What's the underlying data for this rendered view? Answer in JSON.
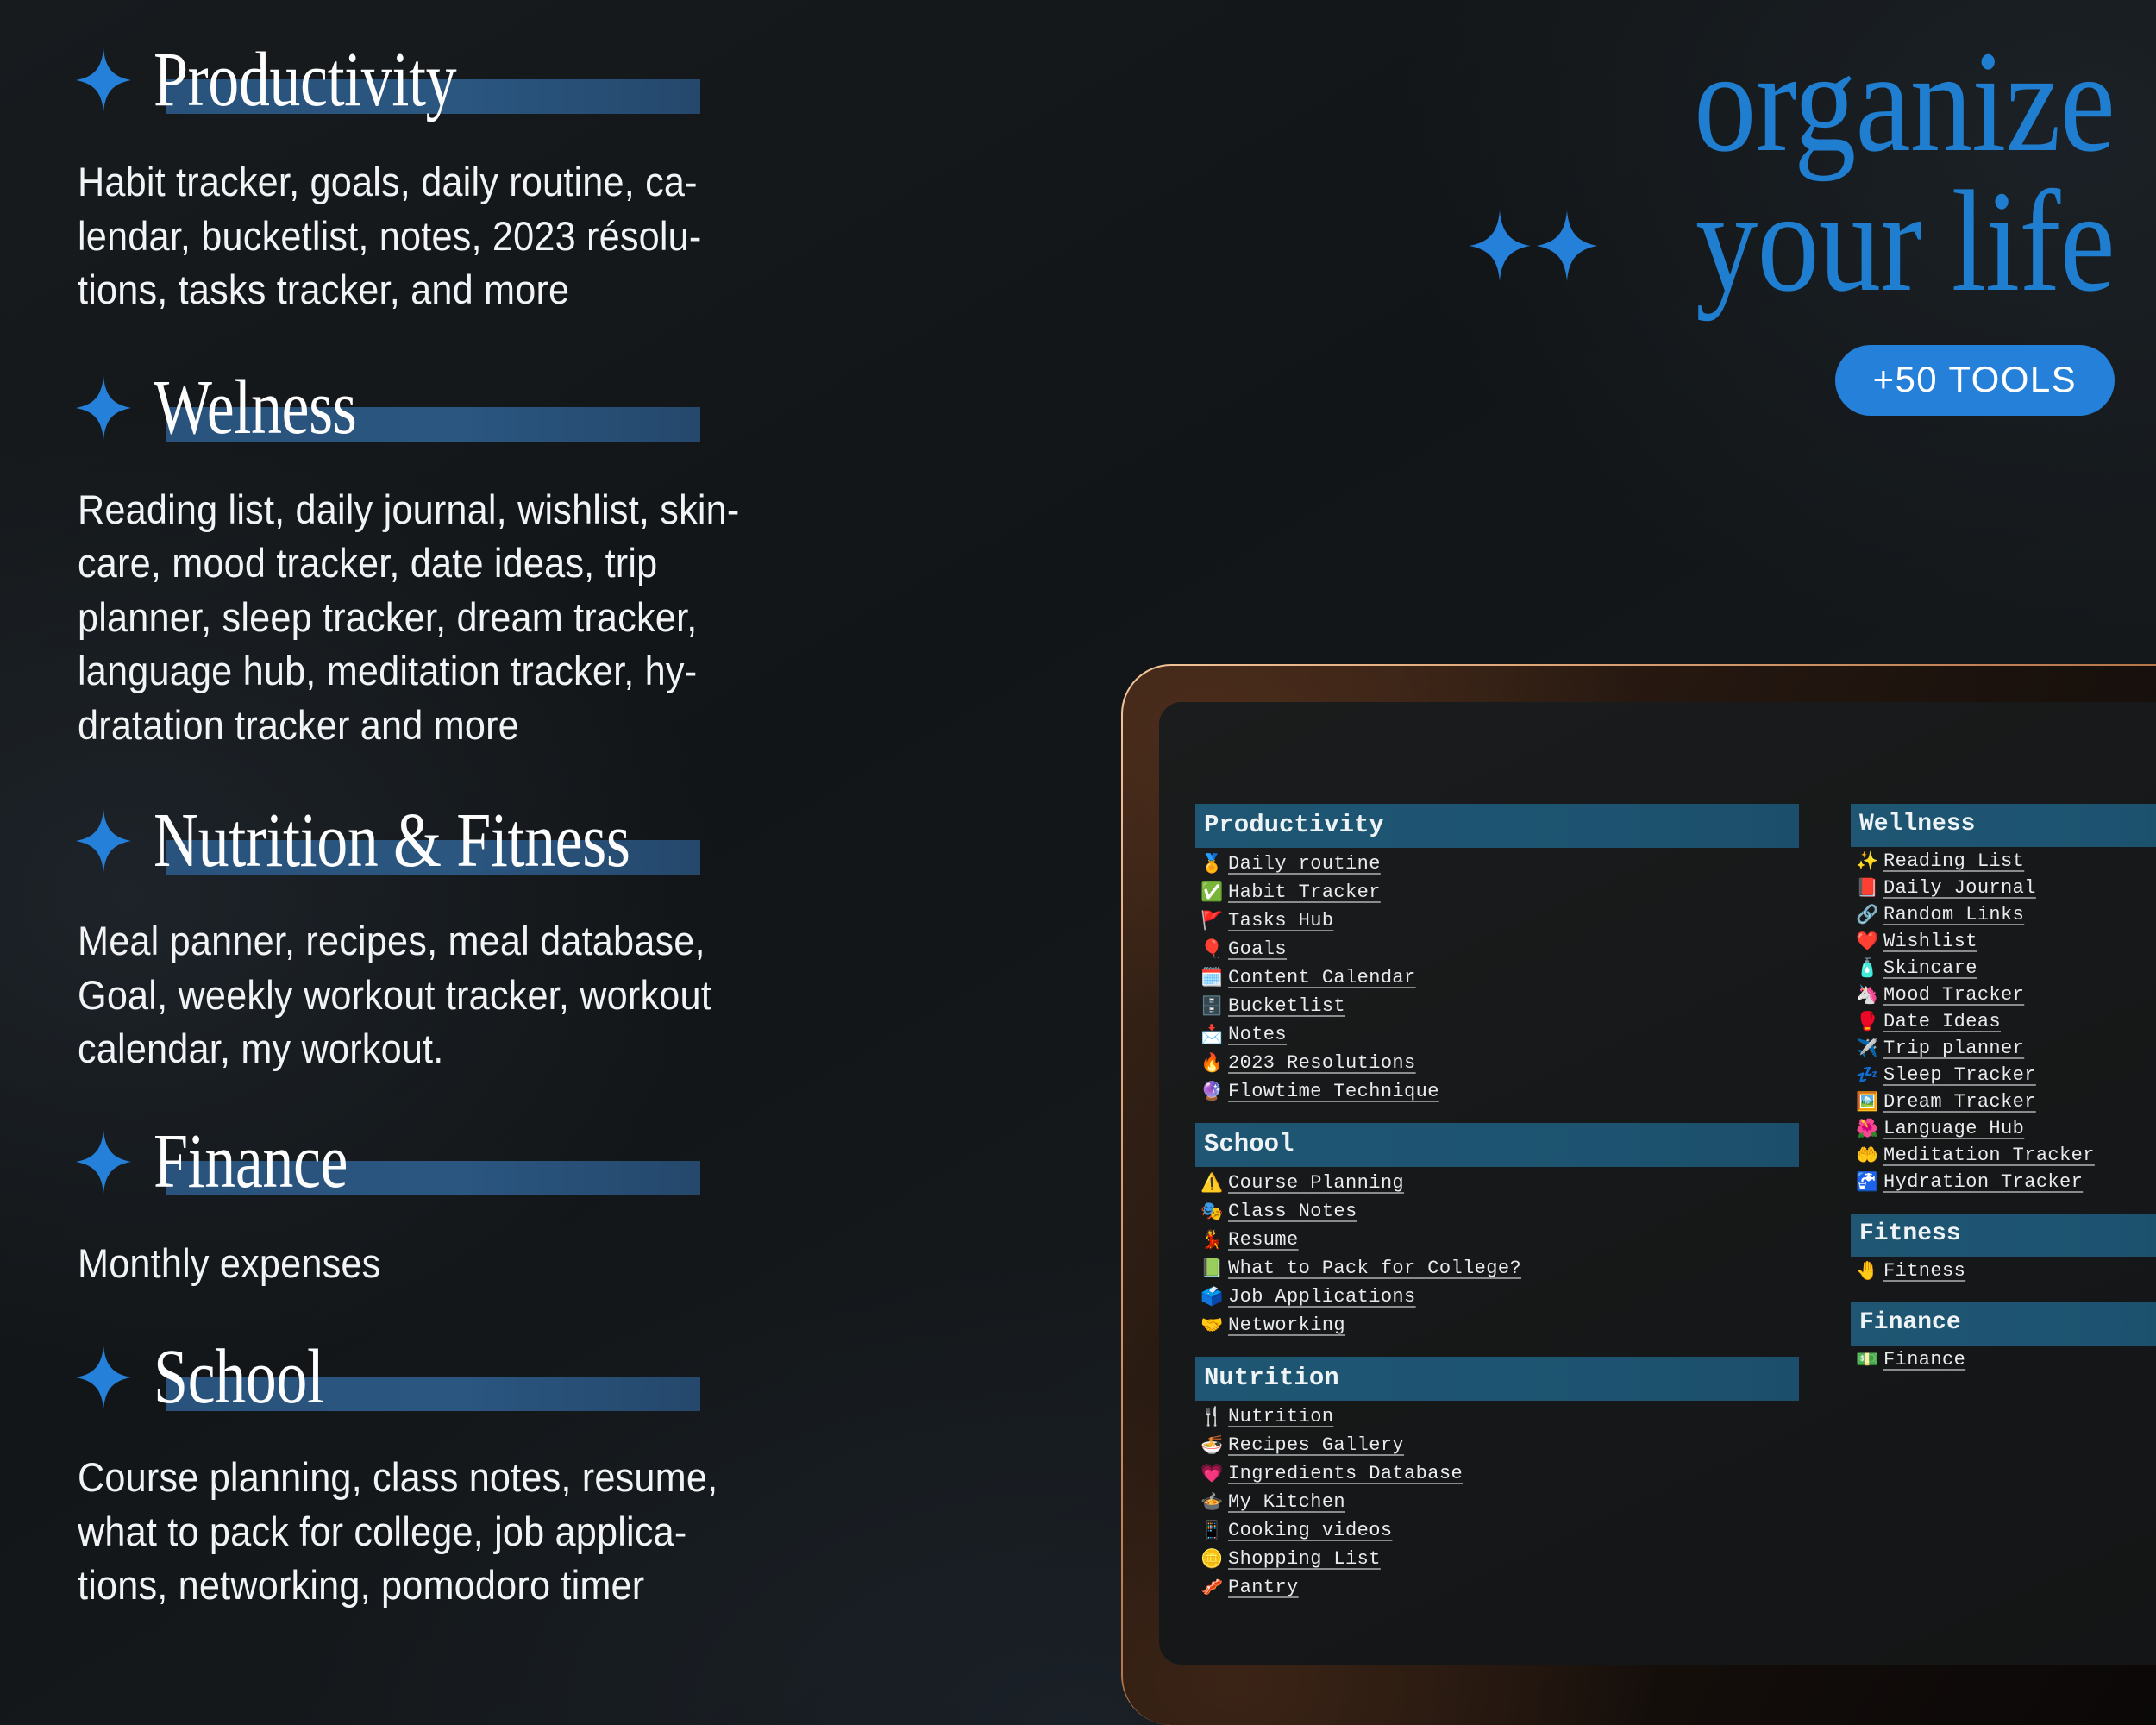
{
  "hero": {
    "line1": "organize",
    "line2": "your life",
    "badge": "+50 TOOLS",
    "sparkle_icon": "sparkle-icon",
    "accent_color": "#1f7ed0",
    "badge_color": "#2480d8"
  },
  "left_sections": [
    {
      "id": "productivity",
      "heading": "Productivity",
      "body": "Habit tracker, goals, daily routine, ca-\nlendar, bucketlist, notes, 2023 résolu-\ntions, tasks tracker, and more"
    },
    {
      "id": "welness",
      "heading": "Welness",
      "body": "Reading list, daily journal, wishlist, skin-\ncare, mood tracker, date ideas, trip\nplanner, sleep tracker, dream tracker,\nlanguage hub, meditation tracker, hy-\ndratation tracker and more"
    },
    {
      "id": "nutrition",
      "heading": "Nutrition & Fitness",
      "body": "Meal panner, recipes, meal database,\nGoal, weekly workout tracker, workout\ncalendar, my workout."
    },
    {
      "id": "finance",
      "heading": "Finance",
      "body": "Monthly expenses"
    },
    {
      "id": "school",
      "heading": "School",
      "body": "Course planning, class notes, resume,\nwhat to pack for college, job applica-\ntions, networking, pomodoro timer"
    }
  ],
  "tablet": {
    "frame_color": "#e0a87b",
    "header_color": "#1d5370",
    "left_column": [
      {
        "title": "Productivity",
        "items": [
          {
            "emoji": "🏅",
            "label": "Daily routine"
          },
          {
            "emoji": "✅",
            "label": "Habit Tracker"
          },
          {
            "emoji": "🚩",
            "label": "Tasks Hub"
          },
          {
            "emoji": "🎈",
            "label": "Goals"
          },
          {
            "emoji": "🗓️",
            "label": "Content Calendar"
          },
          {
            "emoji": "🗄️",
            "label": "Bucketlist"
          },
          {
            "emoji": "📩",
            "label": "Notes"
          },
          {
            "emoji": "🔥",
            "label": "2023 Resolutions"
          },
          {
            "emoji": "🔮",
            "label": "Flowtime Technique"
          }
        ]
      },
      {
        "title": "School",
        "items": [
          {
            "emoji": "⚠️",
            "label": "Course Planning"
          },
          {
            "emoji": "🎭",
            "label": "Class Notes"
          },
          {
            "emoji": "💃",
            "label": "Resume"
          },
          {
            "emoji": "📗",
            "label": "What to Pack for College?"
          },
          {
            "emoji": "🗳️",
            "label": "Job Applications"
          },
          {
            "emoji": "🤝",
            "label": "Networking"
          }
        ]
      },
      {
        "title": "Nutrition",
        "items": [
          {
            "emoji": "🍴",
            "label": "Nutrition"
          },
          {
            "emoji": "🍜",
            "label": "Recipes Gallery"
          },
          {
            "emoji": "💗",
            "label": "Ingredients Database"
          },
          {
            "emoji": "🍲",
            "label": "My Kitchen"
          },
          {
            "emoji": "📱",
            "label": "Cooking videos"
          },
          {
            "emoji": "🪙",
            "label": "Shopping List"
          },
          {
            "emoji": "🥓",
            "label": "Pantry"
          }
        ]
      }
    ],
    "right_column": [
      {
        "title": "Wellness",
        "items": [
          {
            "emoji": "✨",
            "label": "Reading List"
          },
          {
            "emoji": "📕",
            "label": "Daily Journal"
          },
          {
            "emoji": "🔗",
            "label": "Random Links"
          },
          {
            "emoji": "❤️",
            "label": "Wishlist"
          },
          {
            "emoji": "🧴",
            "label": "Skincare"
          },
          {
            "emoji": "🦄",
            "label": "Mood Tracker"
          },
          {
            "emoji": "🥊",
            "label": "Date Ideas"
          },
          {
            "emoji": "✈️",
            "label": "Trip planner"
          },
          {
            "emoji": "💤",
            "label": "Sleep Tracker"
          },
          {
            "emoji": "🖼️",
            "label": "Dream Tracker"
          },
          {
            "emoji": "🌺",
            "label": "Language Hub"
          },
          {
            "emoji": "🤲",
            "label": "Meditation Tracker"
          },
          {
            "emoji": "🚰",
            "label": "Hydration Tracker"
          }
        ]
      },
      {
        "title": "Fitness",
        "items": [
          {
            "emoji": "🤚",
            "label": "Fitness"
          }
        ]
      },
      {
        "title": "Finance",
        "items": [
          {
            "emoji": "💵",
            "label": "Finance"
          }
        ]
      }
    ]
  }
}
